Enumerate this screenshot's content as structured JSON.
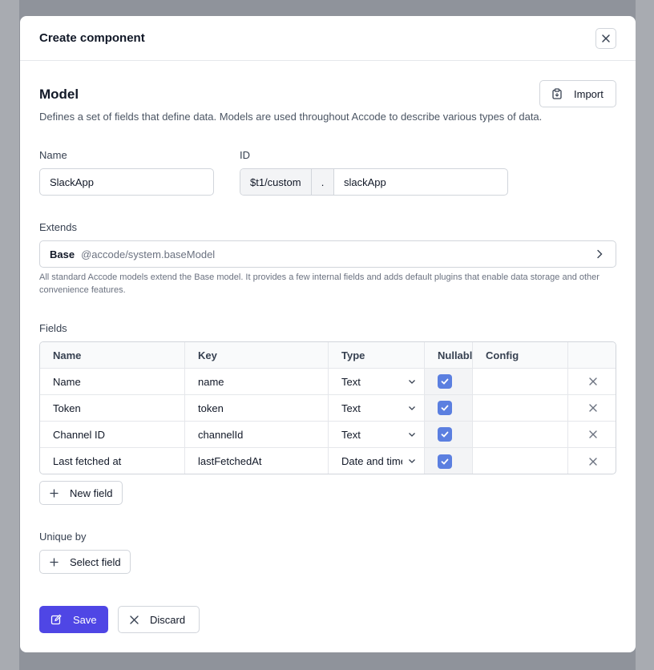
{
  "modal": {
    "title": "Create component"
  },
  "model": {
    "title": "Model",
    "import_label": "Import",
    "description": "Defines a set of fields that define data. Models are used throughout Accode to describe various types of data."
  },
  "name_field": {
    "label": "Name",
    "value": "SlackApp"
  },
  "id_field": {
    "label": "ID",
    "prefix": "$t1/custom",
    "separator": ".",
    "value": "slackApp"
  },
  "extends": {
    "label": "Extends",
    "name": "Base",
    "path": "@accode/system.baseModel",
    "help": "All standard Accode models extend the Base model. It provides a few internal fields and adds default plugins that enable data storage and other convenience features."
  },
  "fields": {
    "label": "Fields",
    "columns": [
      "Name",
      "Key",
      "Type",
      "Nullable",
      "Config",
      ""
    ],
    "rows": [
      {
        "name": "Name",
        "key": "name",
        "type": "Text",
        "nullable": true
      },
      {
        "name": "Token",
        "key": "token",
        "type": "Text",
        "nullable": true
      },
      {
        "name": "Channel ID",
        "key": "channelId",
        "type": "Text",
        "nullable": true
      },
      {
        "name": "Last fetched at",
        "key": "lastFetchedAt",
        "type": "Date and time",
        "nullable": true
      }
    ],
    "new_field_label": "New field"
  },
  "unique_by": {
    "label": "Unique by",
    "select_label": "Select field"
  },
  "actions": {
    "save_label": "Save",
    "discard_label": "Discard"
  },
  "colors": {
    "primary": "#4f46e5",
    "checkbox": "#5b7fe0",
    "backdrop": "#8f939b"
  }
}
